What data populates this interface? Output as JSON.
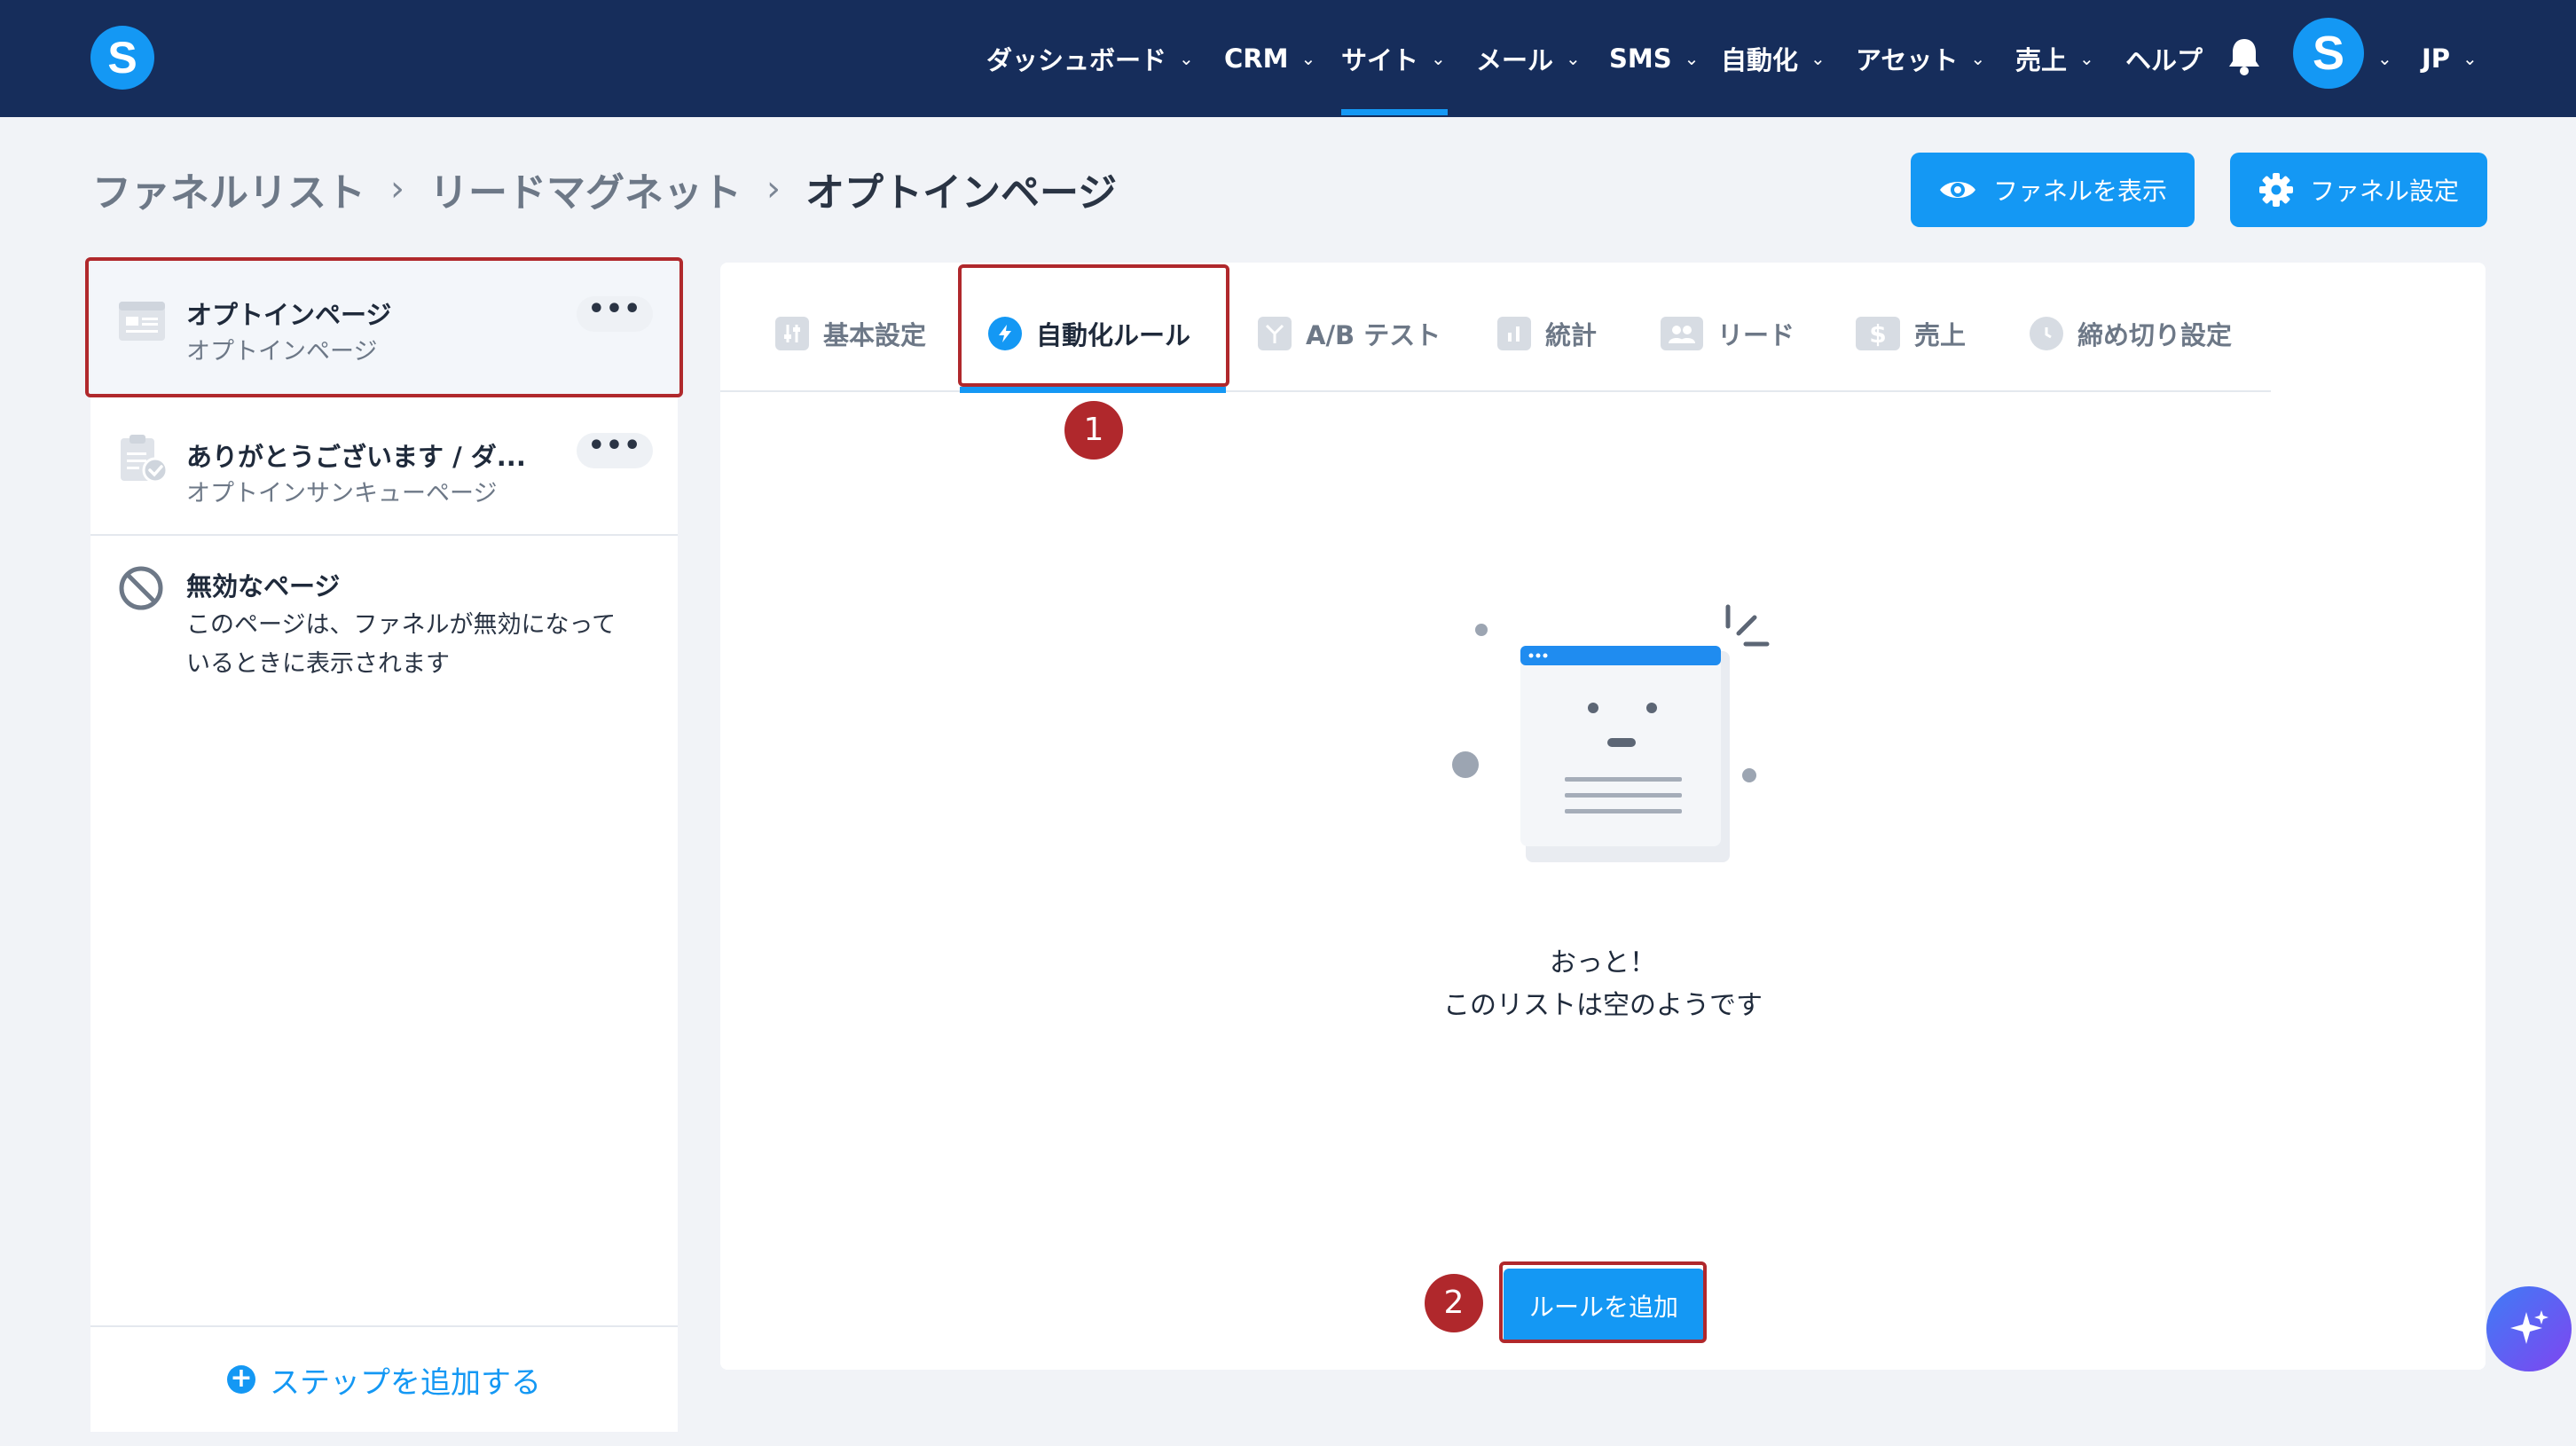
{
  "app": {
    "logo_letter": "S",
    "avatar_letter": "S",
    "language": "JP"
  },
  "nav": {
    "items": [
      {
        "label": "ダッシュボード"
      },
      {
        "label": "CRM"
      },
      {
        "label": "サイト",
        "active": true
      },
      {
        "label": "メール"
      },
      {
        "label": "SMS"
      },
      {
        "label": "自動化"
      },
      {
        "label": "アセット"
      },
      {
        "label": "売上"
      },
      {
        "label": "ヘルプ"
      }
    ]
  },
  "breadcrumb": {
    "items": [
      "ファネルリスト",
      "リードマグネット",
      "オプトインページ"
    ]
  },
  "header_buttons": {
    "view_funnel": "ファネルを表示",
    "funnel_settings": "ファネル設定"
  },
  "sidebar": {
    "steps": [
      {
        "title": "オプトインページ",
        "subtitle": "オプトインページ",
        "menu": "•••",
        "selected": true
      },
      {
        "title": "ありがとうございます / ダ...",
        "subtitle": "オプトインサンキューページ",
        "menu": "•••"
      },
      {
        "title": "無効なページ",
        "subtitle_line1": "このページは、ファネルが無効になって",
        "subtitle_line2": "いるときに表示されます"
      }
    ],
    "add_step": "ステップを追加する"
  },
  "tabs": {
    "items": [
      {
        "label": "基本設定",
        "icon": "sliders-icon"
      },
      {
        "label": "自動化ルール",
        "icon": "lightning-icon",
        "active": true
      },
      {
        "label": "A/B テスト",
        "icon": "split-icon"
      },
      {
        "label": "統計",
        "icon": "bar-chart-icon"
      },
      {
        "label": "リード",
        "icon": "users-icon"
      },
      {
        "label": "売上",
        "icon": "dollar-icon"
      },
      {
        "label": "締め切り設定",
        "icon": "clock-icon"
      }
    ]
  },
  "empty_state": {
    "title": "おっと！",
    "subtitle": "このリストは空のようです"
  },
  "add_rule_button": "ルールを追加",
  "annotations": {
    "badge_1": "1",
    "badge_2": "2"
  },
  "colors": {
    "nav_bg": "#162d5b",
    "accent": "#1498f4",
    "highlight": "#b0282c"
  }
}
